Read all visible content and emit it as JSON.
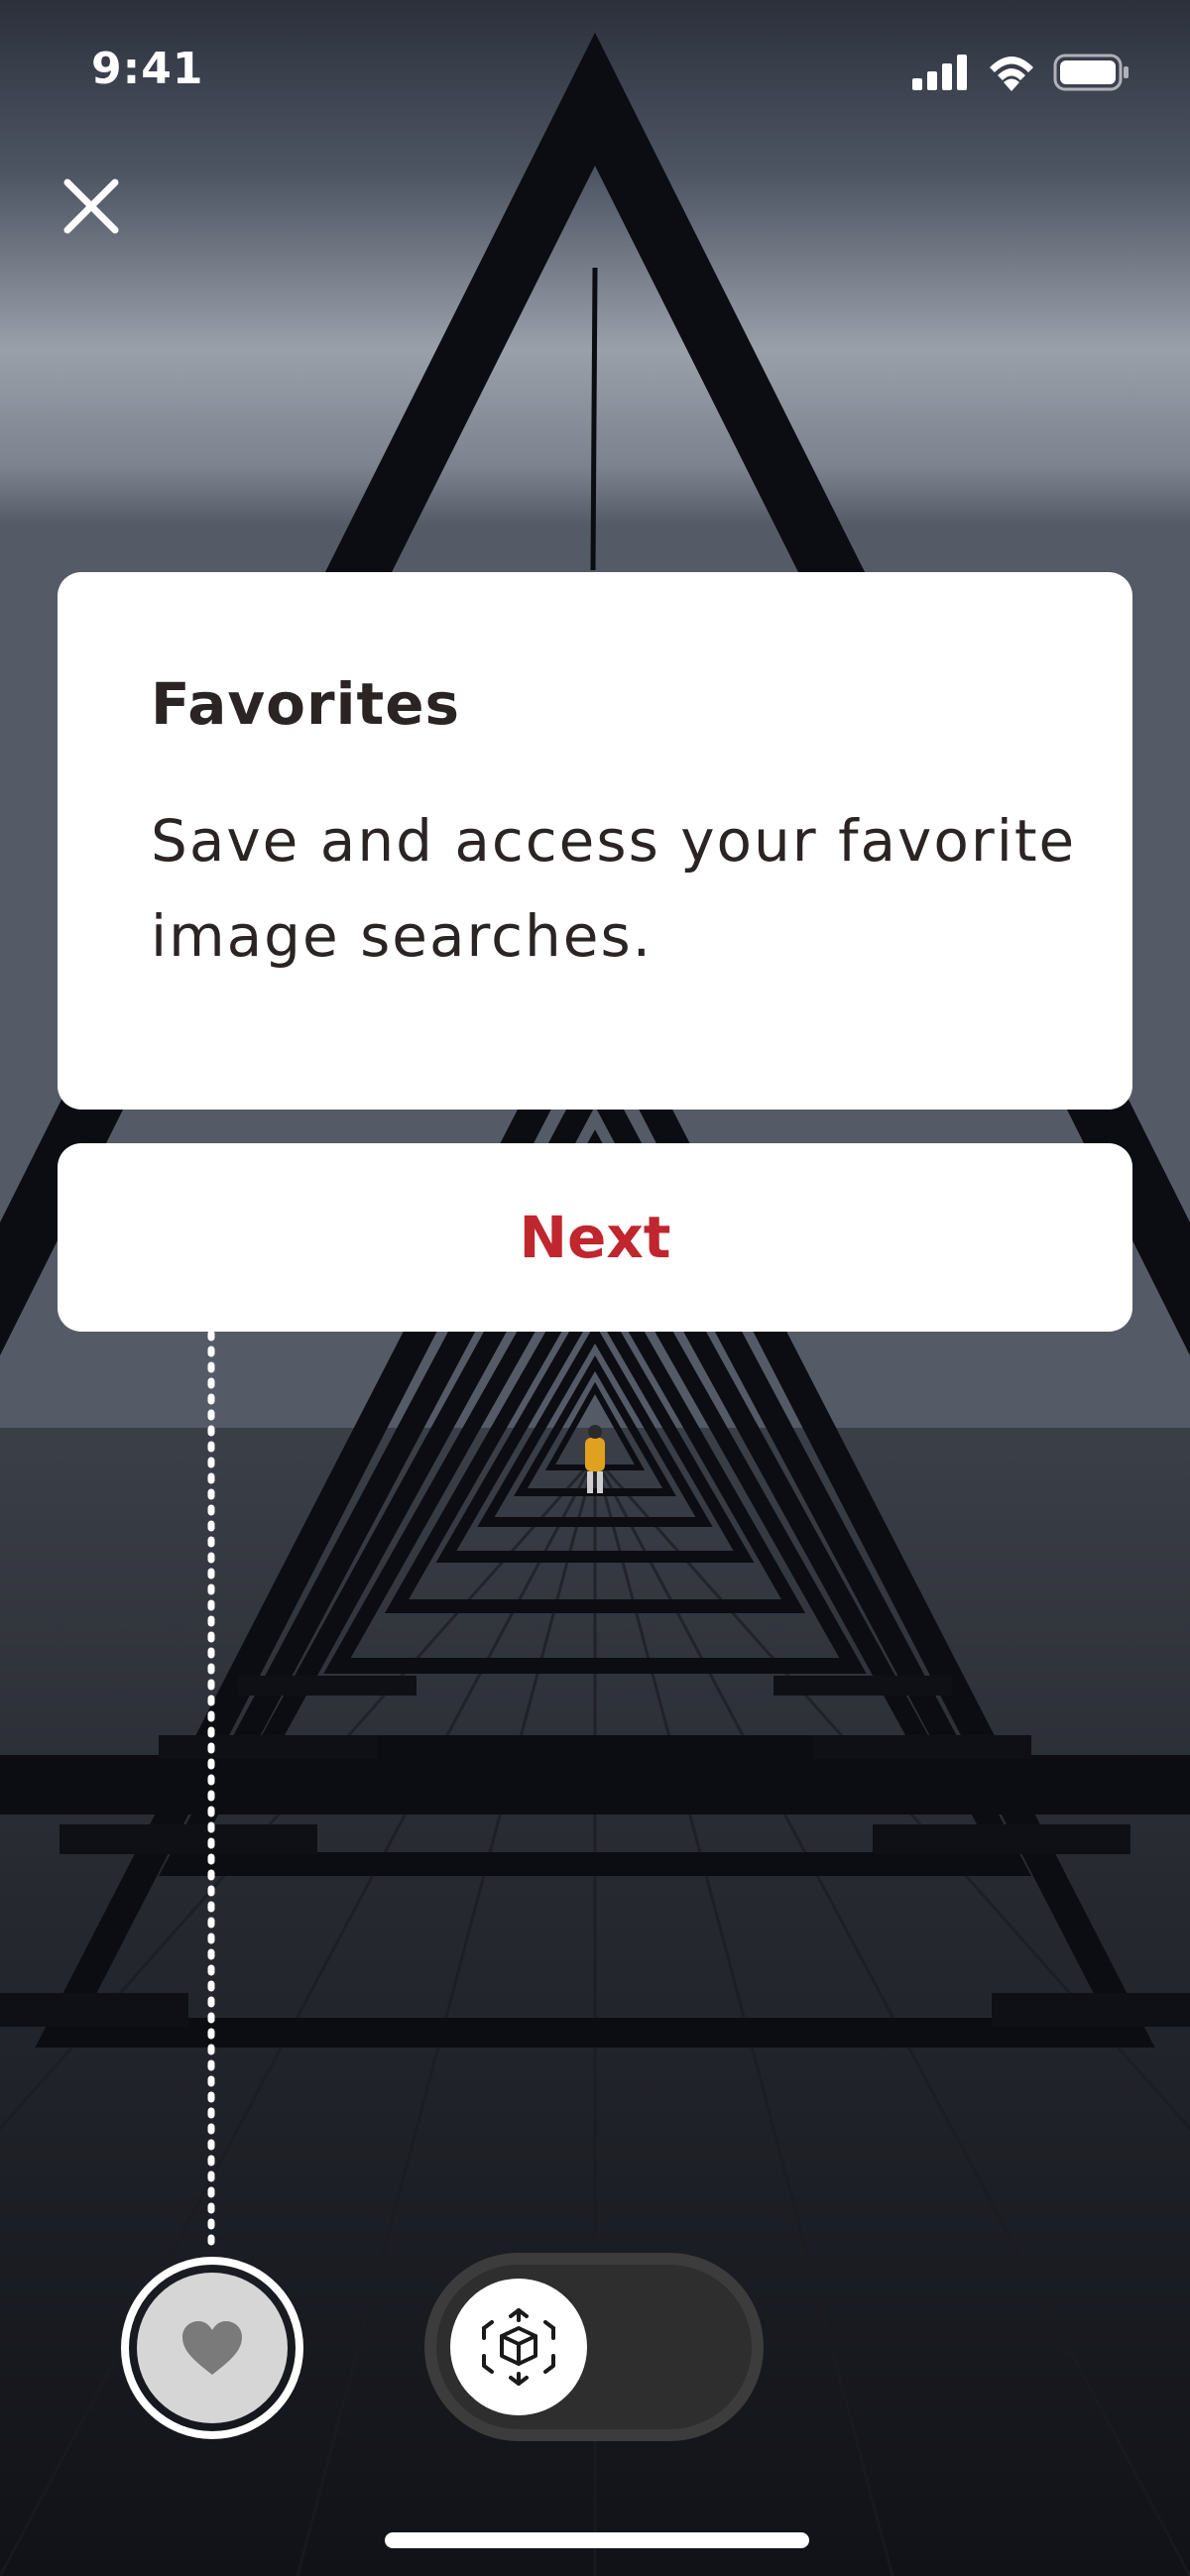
{
  "status_bar": {
    "time": "9:41",
    "icons": [
      "cellular-signal-icon",
      "wifi-icon",
      "battery-icon"
    ]
  },
  "close_icon": "close-icon",
  "coachmark": {
    "title": "Favorites",
    "body": "Save and access your favorite image searches.",
    "next_label": "Next"
  },
  "bottom_controls": {
    "favorites_icon": "heart-icon",
    "ar_toggle_icon": "ar-cube-icon"
  },
  "colors": {
    "accent": "#c0262d",
    "card_background": "#ffffff",
    "text": "#2b2424"
  }
}
